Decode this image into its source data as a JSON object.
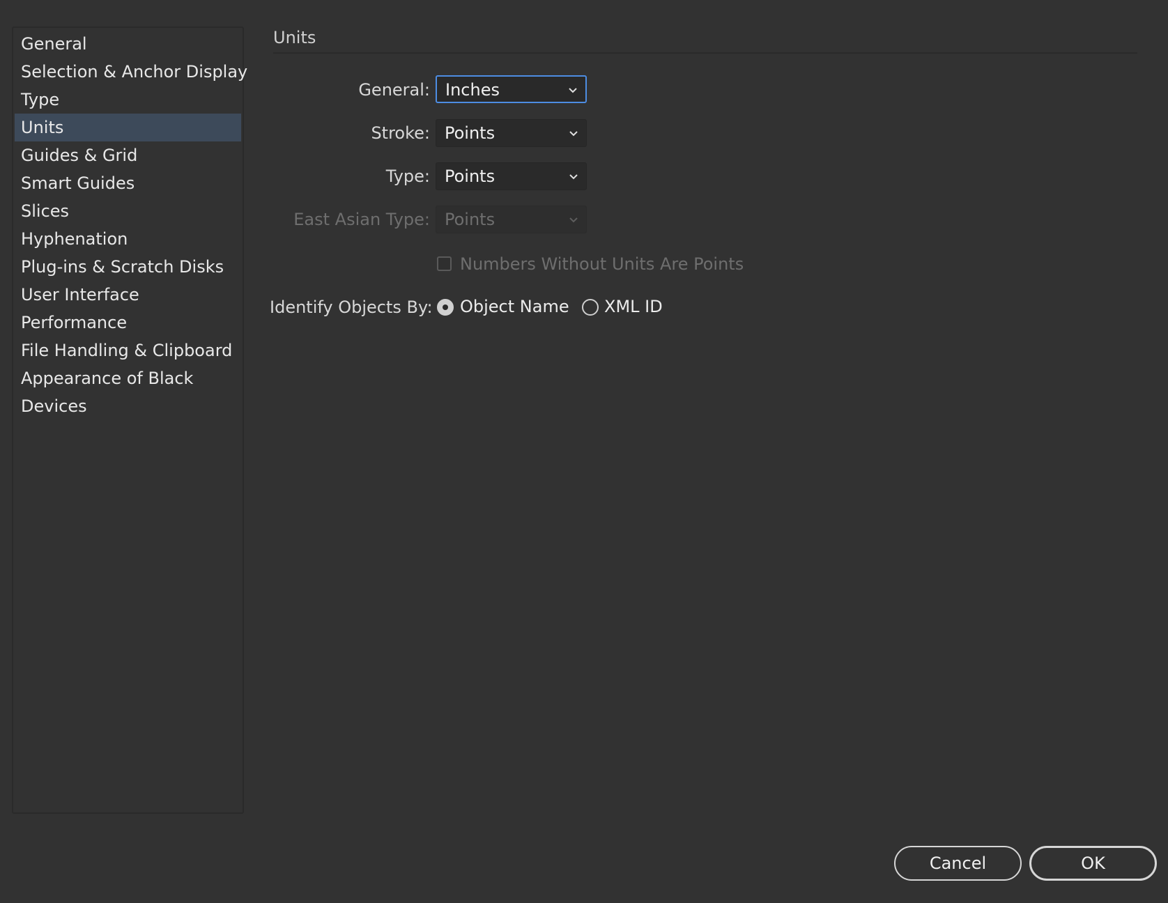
{
  "sidebar": {
    "items": [
      {
        "label": "General"
      },
      {
        "label": "Selection & Anchor Display"
      },
      {
        "label": "Type"
      },
      {
        "label": "Units",
        "selected": true
      },
      {
        "label": "Guides & Grid"
      },
      {
        "label": "Smart Guides"
      },
      {
        "label": "Slices"
      },
      {
        "label": "Hyphenation"
      },
      {
        "label": "Plug-ins & Scratch Disks"
      },
      {
        "label": "User Interface"
      },
      {
        "label": "Performance"
      },
      {
        "label": "File Handling & Clipboard"
      },
      {
        "label": "Appearance of Black"
      },
      {
        "label": "Devices"
      }
    ]
  },
  "section": {
    "title": "Units"
  },
  "form": {
    "general": {
      "label": "General:",
      "value": "Inches"
    },
    "stroke": {
      "label": "Stroke:",
      "value": "Points"
    },
    "type": {
      "label": "Type:",
      "value": "Points"
    },
    "east_asian_type": {
      "label": "East Asian Type:",
      "value": "Points",
      "disabled": true
    },
    "numbers_without_units": {
      "label": "Numbers Without Units Are Points",
      "checked": false,
      "disabled": true
    },
    "identify_objects": {
      "label": "Identify Objects By:",
      "options": [
        {
          "label": "Object Name",
          "selected": true
        },
        {
          "label": "XML ID",
          "selected": false
        }
      ]
    }
  },
  "buttons": {
    "cancel": "Cancel",
    "ok": "OK"
  },
  "colors": {
    "background": "#323232",
    "selected_item": "#3d4a5a",
    "focus_ring": "#4d8de3"
  }
}
